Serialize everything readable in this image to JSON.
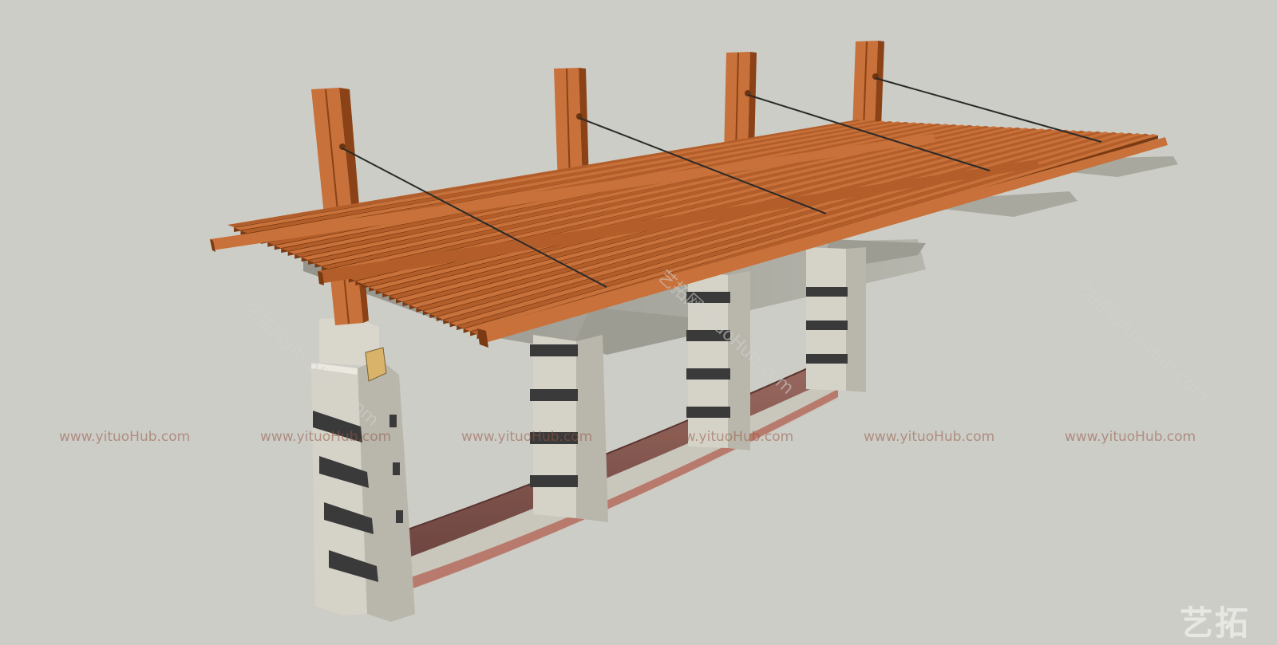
{
  "scene": {
    "colors": {
      "background": "#cdcdc7",
      "wood_light": "#c8713a",
      "wood_mid": "#b35e2a",
      "wood_dark": "#7a3a12",
      "stone_light": "#dedcd2",
      "stone_mid": "#c4c2b6",
      "stone_dark": "#9e9c92",
      "band": "#3a3a3a",
      "cushion": "#8a5a52",
      "cushion_dark": "#6e4540",
      "cable": "#2a2a2a",
      "lamp": "#d9b36a"
    },
    "post_count": 4,
    "slat_count": 38
  },
  "watermarks": {
    "repeat_text": "www.yituoHub.com",
    "diagonal_text": "艺拓网yituoHub.com",
    "logo_text": "艺拓"
  }
}
